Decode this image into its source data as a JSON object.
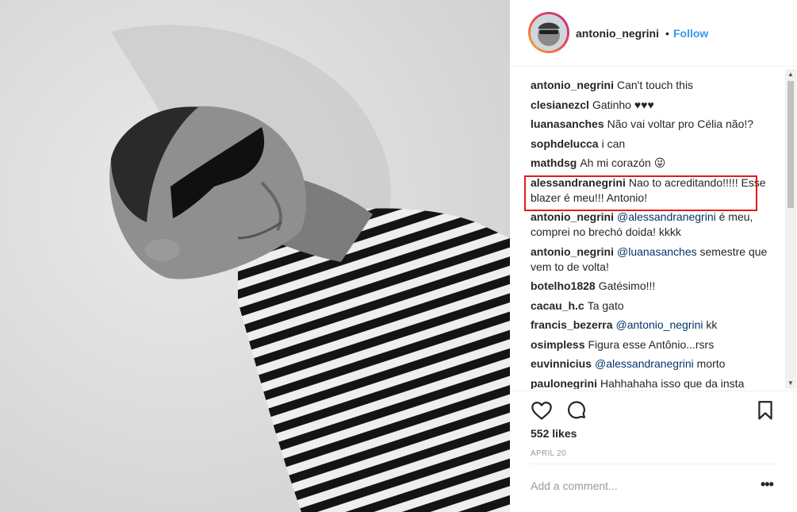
{
  "post": {
    "username": "antonio_negrini",
    "separator": "•",
    "follow_label": "Follow",
    "likes": "552 likes",
    "date": "APRIL 20",
    "add_comment_placeholder": "Add a comment...",
    "more_label": "•••"
  },
  "comments": [
    {
      "user": "antonio_negrini",
      "text": "Can't touch this",
      "mention": ""
    },
    {
      "user": "clesianezcl",
      "text": "Gatinho ♥♥♥",
      "mention": ""
    },
    {
      "user": "luanasanches",
      "text": "Não vai voltar pro Célia não!?",
      "mention": ""
    },
    {
      "user": "sophdelucca",
      "text": "i can",
      "mention": ""
    },
    {
      "user": "mathdsg",
      "text": "Ah mi corazón 😜",
      "mention": ""
    },
    {
      "user": "alessandranegrini",
      "text": "Nao to acreditando!!!!! Esse blazer é meu!!! Antonio!",
      "mention": "",
      "highlighted": true
    },
    {
      "user": "antonio_negrini",
      "mention": "@alessandranegrini",
      "text": "é meu, comprei no brechó doida! kkkk"
    },
    {
      "user": "antonio_negrini",
      "mention": "@luanasanches",
      "text": "semestre que vem to de volta!"
    },
    {
      "user": "botelho1828",
      "text": "Gatésimo!!!",
      "mention": ""
    },
    {
      "user": "cacau_h.c",
      "text": "Ta gato",
      "mention": ""
    },
    {
      "user": "francis_bezerra",
      "mention": "@antonio_negrini",
      "text": "kk"
    },
    {
      "user": "osimpless",
      "text": "Figura esse Antônio...rsrs",
      "mention": ""
    },
    {
      "user": "euvinnicius",
      "mention": "@alessandranegrini",
      "text": "morto"
    },
    {
      "user": "paulonegrini",
      "text": "Hahhahaha isso que da insta",
      "mention": ""
    }
  ],
  "icons": {
    "like": "heart-icon",
    "comment": "comment-bubble-icon",
    "save": "bookmark-icon",
    "scroll_up": "▲",
    "scroll_down": "▼"
  },
  "colors": {
    "follow": "#3897f0",
    "highlight_box": "#e21b1b",
    "mention": "#003569"
  }
}
